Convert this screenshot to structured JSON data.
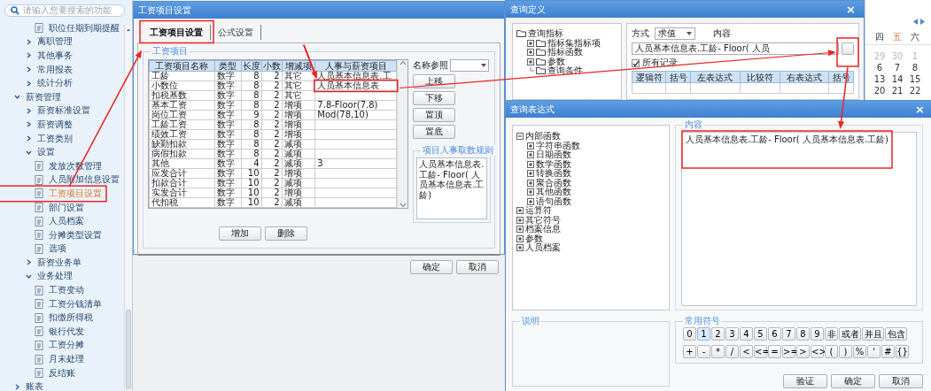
{
  "sidebar": {
    "search": {
      "placeholder": "请输入您要搜索的功能"
    },
    "items": [
      {
        "children": [
          {
            "children": [
              {
                "label": "职位任期到期提醒",
                "selected": false
              }
            ]
          },
          {
            "label": "离职管理",
            "expanded": false
          },
          {
            "label": "其他事务",
            "expanded": false
          },
          {
            "label": "常用报表",
            "expanded": false
          },
          {
            "label": "统计分析",
            "expanded": false
          }
        ]
      },
      {
        "label": "薪资管理",
        "expanded": true,
        "children": [
          {
            "label": "薪资标准设置",
            "expanded": false
          },
          {
            "label": "薪资调整",
            "expanded": false
          },
          {
            "label": "工资类别",
            "expanded": false
          },
          {
            "label": "设置",
            "expanded": true,
            "children": [
              {
                "label": "发放次数管理",
                "selected": false
              },
              {
                "label": "人员附加信息设置",
                "selected": false
              },
              {
                "label": "工资项目设置",
                "selected": true
              },
              {
                "label": "部门设置",
                "selected": false
              },
              {
                "label": "人员档案",
                "selected": false
              },
              {
                "label": "分摊类型设置",
                "selected": false
              },
              {
                "label": "选项",
                "selected": false
              }
            ]
          },
          {
            "label": "薪资业务单",
            "expanded": false
          },
          {
            "label": "业务处理",
            "expanded": true,
            "children": [
              {
                "label": "工资变动",
                "selected": false
              },
              {
                "label": "工资分钱清单",
                "selected": false
              },
              {
                "label": "扣缴所得税",
                "selected": false
              },
              {
                "label": "银行代发",
                "selected": false
              },
              {
                "label": "工资分摊",
                "selected": false
              },
              {
                "label": "月末处理",
                "selected": false
              },
              {
                "label": "反结账",
                "selected": false
              }
            ]
          }
        ]
      },
      {
        "label": "账表",
        "expanded": false
      }
    ]
  },
  "salary_dialog": {
    "title": "工资项目设置",
    "tabs": [
      {
        "label": "工资项目设置",
        "selected": true
      },
      {
        "label": "公式设置",
        "selected": false
      }
    ],
    "group_title": "工资项目",
    "table": {
      "columns": [
        "工资项目名称",
        "类型",
        "长度",
        "小数",
        "增减项",
        "人事与薪资项目"
      ],
      "rows": [
        [
          "工龄",
          "数字",
          "8",
          "2",
          "其它",
          "人员基本信息表.工"
        ],
        [
          "小数位",
          "数字",
          "8",
          "2",
          "其它",
          "人员基本信息表"
        ],
        [
          "扣税基数",
          "数字",
          "8",
          "2",
          "其它",
          ""
        ],
        [
          "基本工资",
          "数字",
          "8",
          "2",
          "增项",
          "7.8-Floor(7.8)"
        ],
        [
          "岗位工资",
          "数字",
          "9",
          "2",
          "增项",
          "Mod(78,10)"
        ],
        [
          "工龄工资",
          "数字",
          "8",
          "2",
          "增项",
          ""
        ],
        [
          "绩效工资",
          "数字",
          "8",
          "2",
          "增项",
          ""
        ],
        [
          "缺勤扣款",
          "数字",
          "8",
          "2",
          "减项",
          ""
        ],
        [
          "病假扣款",
          "数字",
          "8",
          "2",
          "减项",
          ""
        ],
        [
          "其他",
          "数字",
          "4",
          "2",
          "减项",
          "3"
        ],
        [
          "应发合计",
          "数字",
          "10",
          "2",
          "增项",
          ""
        ],
        [
          "扣款合计",
          "数字",
          "10",
          "2",
          "减项",
          ""
        ],
        [
          "实发合计",
          "数字",
          "10",
          "2",
          "增项",
          ""
        ],
        [
          "代扣税",
          "数字",
          "10",
          "2",
          "减项",
          ""
        ]
      ]
    },
    "name_ref_label": "名称参照",
    "move_buttons": [
      "上移",
      "下移",
      "置顶",
      "置底"
    ],
    "rule_group_title": "项目人事取数规则",
    "rule_text": "人员基本信息表.工龄- Floor( 人员基本信息表.工龄)",
    "table_buttons": [
      "增加",
      "删除"
    ],
    "buttons": [
      "确定",
      "取消"
    ]
  },
  "query_dialog": {
    "title": "查询定义",
    "close": "×",
    "tree": [
      {
        "label": "查询指标",
        "children": [
          {
            "label": "指标集指标项",
            "expanded": false
          },
          {
            "label": "指标函数",
            "expanded": false
          },
          {
            "label": "参数",
            "expanded": false
          },
          {
            "label": "查询条件"
          }
        ]
      }
    ],
    "mode_label": "方式",
    "mode_value": "求值",
    "content_label": "内容",
    "content_value": "人员基本信息表.工龄- Floor( 人员",
    "all_records": {
      "label": "所有记录",
      "checked": true
    },
    "columns": [
      "逻辑符",
      "括号",
      "左表达式",
      "比较符",
      "右表达式",
      "括号"
    ]
  },
  "calendar": {
    "weekdays": [
      {
        "label": "四",
        "highlighted": false
      },
      {
        "label": "五",
        "highlighted": true
      },
      {
        "label": "六",
        "highlighted": false
      }
    ],
    "weeks": [
      [
        {
          "label": "29",
          "other_month": true
        },
        {
          "label": "30",
          "other_month": true
        },
        {
          "label": "1",
          "other_month": true
        }
      ],
      [
        {
          "label": "6",
          "other_month": false
        },
        {
          "label": "7",
          "other_month": false
        },
        {
          "label": "8",
          "other_month": false
        }
      ],
      [
        {
          "label": "13",
          "other_month": false
        },
        {
          "label": "14",
          "other_month": false
        },
        {
          "label": "15",
          "other_month": false
        }
      ],
      [
        {
          "label": "20",
          "other_month": false
        },
        {
          "label": "21",
          "other_month": false
        },
        {
          "label": "22",
          "other_month": false
        }
      ]
    ]
  },
  "expression_dialog": {
    "title": "查询表达式",
    "close": "×",
    "tree": [
      {
        "label": "内部函数",
        "expanded": true,
        "children": [
          {
            "label": "字符串函数",
            "expanded": false
          },
          {
            "label": "日期函数",
            "expanded": false
          },
          {
            "label": "数学函数",
            "expanded": false
          },
          {
            "label": "转换函数",
            "expanded": false
          },
          {
            "label": "聚合函数",
            "expanded": false
          },
          {
            "label": "其他函数",
            "expanded": false
          },
          {
            "label": "语句函数",
            "expanded": false
          }
        ]
      },
      {
        "label": "运算符",
        "expanded": false
      },
      {
        "label": "其它符号",
        "expanded": false
      },
      {
        "label": "档案信息",
        "expanded": false
      },
      {
        "label": "参数",
        "expanded": false
      },
      {
        "label": "人员档案",
        "expanded": false
      }
    ],
    "content_title": "内容",
    "content_text": "人员基本信息表.工龄- Floor( 人员基本信息表.工龄)",
    "notes_title": "说明",
    "symbols_title": "常用符号",
    "symbol_rows": [
      [
        {
          "label": "0",
          "selected": false
        },
        {
          "label": "1",
          "selected": true
        },
        {
          "label": "2",
          "selected": false
        },
        {
          "label": "3",
          "selected": false
        },
        {
          "label": "4",
          "selected": false
        },
        {
          "label": "5",
          "selected": false
        },
        {
          "label": "6",
          "selected": false
        },
        {
          "label": "7",
          "selected": false
        },
        {
          "label": "8",
          "selected": false
        },
        {
          "label": "9",
          "selected": false
        },
        {
          "label": "非",
          "selected": false
        },
        {
          "label": "或者",
          "selected": false
        },
        {
          "label": "并且",
          "selected": false
        },
        {
          "label": "包含",
          "selected": false
        }
      ],
      [
        {
          "label": "+",
          "selected": false
        },
        {
          "label": "-",
          "selected": false
        },
        {
          "label": "*",
          "selected": false
        },
        {
          "label": "/",
          "selected": false
        },
        {
          "label": "<",
          "selected": false
        },
        {
          "label": "<=",
          "selected": false
        },
        {
          "label": "=",
          "selected": false
        },
        {
          "label": ">=",
          "selected": false
        },
        {
          "label": ">",
          "selected": false
        },
        {
          "label": "<>",
          "selected": false
        },
        {
          "label": "(",
          "selected": false
        },
        {
          "label": ")",
          "selected": false
        },
        {
          "label": "%",
          "selected": false
        },
        {
          "label": "'",
          "selected": false
        },
        {
          "label": "#",
          "selected": false
        },
        {
          "label": "{}",
          "selected": false
        }
      ]
    ],
    "buttons": [
      "验证",
      "确定",
      "取消"
    ]
  }
}
